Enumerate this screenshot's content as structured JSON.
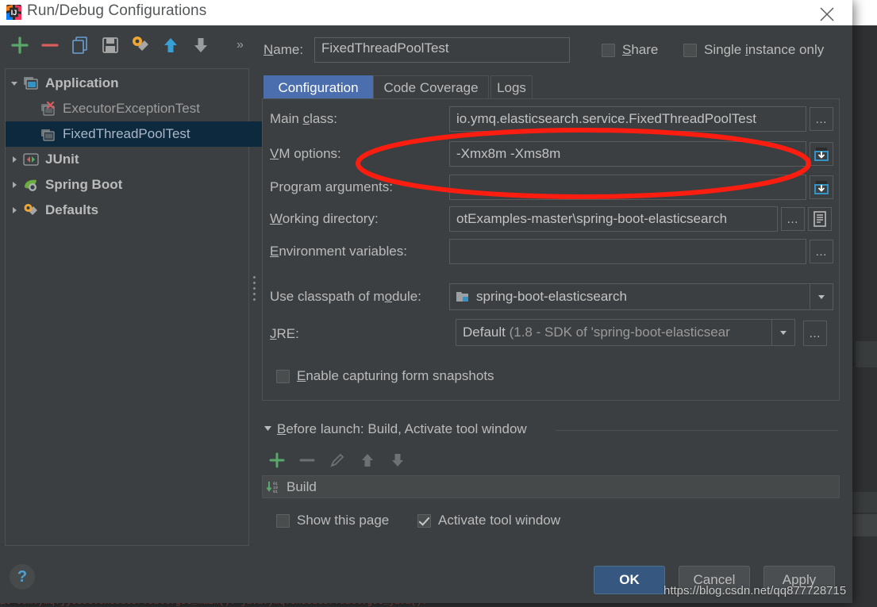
{
  "window": {
    "title": "Run/Debug Configurations",
    "app_icon": "intellij-idea-icon",
    "close_icon": "close-icon"
  },
  "toolbar": {
    "buttons": [
      {
        "name": "add-configuration-button",
        "icon": "plus-icon",
        "label": "+"
      },
      {
        "name": "remove-configuration-button",
        "icon": "minus-icon",
        "label": "−"
      },
      {
        "name": "copy-configuration-button",
        "icon": "copy-icon",
        "label": ""
      },
      {
        "name": "save-configuration-button",
        "icon": "save-floppy-icon",
        "label": ""
      },
      {
        "name": "edit-defaults-button",
        "icon": "wrench-gear-icon",
        "label": ""
      },
      {
        "name": "move-up-button",
        "icon": "arrow-up-icon",
        "label": ""
      },
      {
        "name": "move-down-button",
        "icon": "arrow-down-icon",
        "label": ""
      }
    ],
    "overflow_label": "»"
  },
  "name_field": {
    "label": "Name:",
    "label_mnemonic": "N",
    "value": "FixedThreadPoolTest",
    "placeholder": ""
  },
  "header_checkboxes": [
    {
      "name": "share-checkbox",
      "label": "Share",
      "mnemonic": "S",
      "checked": false
    },
    {
      "name": "single-instance-checkbox",
      "label": "Single instance only",
      "mnemonic": "i",
      "checked": false
    }
  ],
  "tree": {
    "nodes": [
      {
        "label": "Application",
        "icon": "application-folder-icon",
        "expanded": true,
        "bold": true,
        "indent": 0,
        "selected": false,
        "arrow": "down"
      },
      {
        "label": "ExecutorExceptionTest",
        "icon": "application-run-error-icon",
        "expanded": false,
        "bold": false,
        "indent": 1,
        "selected": false,
        "arrow": "none"
      },
      {
        "label": "FixedThreadPoolTest",
        "icon": "application-run-icon",
        "expanded": false,
        "bold": false,
        "indent": 1,
        "selected": true,
        "arrow": "none"
      },
      {
        "label": "JUnit",
        "icon": "junit-icon",
        "expanded": false,
        "bold": true,
        "indent": 0,
        "selected": false,
        "arrow": "right"
      },
      {
        "label": "Spring Boot",
        "icon": "spring-boot-leaf-icon",
        "expanded": false,
        "bold": true,
        "indent": 0,
        "selected": false,
        "arrow": "right"
      },
      {
        "label": "Defaults",
        "icon": "defaults-wrench-icon",
        "expanded": false,
        "bold": true,
        "indent": 0,
        "selected": false,
        "arrow": "right"
      }
    ]
  },
  "tabs": [
    {
      "name": "tab-configuration",
      "label": "Configuration",
      "active": true
    },
    {
      "name": "tab-code-coverage",
      "label": "Code Coverage",
      "active": false
    },
    {
      "name": "tab-logs",
      "label": "Logs",
      "active": false
    }
  ],
  "configuration": {
    "main_class": {
      "label": "Main class:",
      "mnemonic": "c",
      "value": "io.ymq.elasticsearch.service.FixedThreadPoolTest",
      "browse_label": "…"
    },
    "vm_options": {
      "label": "VM options:",
      "mnemonic": "V",
      "value": "-Xmx8m -Xms8m",
      "expand_icon": "expand-editor-icon"
    },
    "program_arguments": {
      "label": "Program arguments:",
      "mnemonic": "g",
      "value": "",
      "expand_icon": "expand-editor-icon"
    },
    "working_directory": {
      "label": "Working directory:",
      "mnemonic": "W",
      "value": "otExamples-master\\spring-boot-elasticsearch",
      "browse_label": "…",
      "macros_icon": "insert-macro-icon"
    },
    "environment_variables": {
      "label": "Environment variables:",
      "mnemonic": "E",
      "value": "",
      "browse_label": "…"
    },
    "classpath_module": {
      "label": "Use classpath of module:",
      "mnemonic": "o",
      "value": "spring-boot-elasticsearch",
      "icon": "module-icon",
      "arrow_icon": "chevron-down-icon"
    },
    "jre": {
      "label": "JRE:",
      "mnemonic": "J",
      "value_main": "Default ",
      "value_dim": "(1.8 - SDK of 'spring-boot-elasticsear",
      "arrow_icon": "chevron-down-icon",
      "browse_label": "…"
    },
    "snapshots_checkbox": {
      "name": "enable-capturing-form-snapshots-checkbox",
      "label": "Enable capturing form snapshots",
      "mnemonic": "E",
      "checked": false
    }
  },
  "before_launch": {
    "header": "Before launch: Build, Activate tool window",
    "mnemonic": "B",
    "collapse_icon": "triangle-down-icon",
    "toolbar": [
      {
        "name": "before-launch-add-button",
        "icon": "plus-icon",
        "enabled": true
      },
      {
        "name": "before-launch-remove-button",
        "icon": "minus-icon",
        "enabled": false
      },
      {
        "name": "before-launch-edit-button",
        "icon": "pencil-icon",
        "enabled": false
      },
      {
        "name": "before-launch-move-up-button",
        "icon": "arrow-up-icon",
        "enabled": false
      },
      {
        "name": "before-launch-move-down-button",
        "icon": "arrow-down-icon",
        "enabled": false
      }
    ],
    "tasks": [
      {
        "label": "Build",
        "icon": "build-compile-icon"
      }
    ],
    "checkboxes": [
      {
        "name": "show-this-page-checkbox",
        "label": "Show this page",
        "checked": false
      },
      {
        "name": "activate-tool-window-checkbox",
        "label": "Activate tool window",
        "checked": true
      }
    ]
  },
  "footer": {
    "help_label": "?",
    "buttons": [
      {
        "name": "ok-button",
        "label": "OK",
        "primary": true
      },
      {
        "name": "cancel-button",
        "label": "Cancel",
        "primary": false
      },
      {
        "name": "apply-button",
        "label": "Apply",
        "primary": false
      }
    ]
  },
  "annotation": {
    "shape": "red-ellipse-highlight",
    "color": "#fb1d10"
  },
  "watermark": {
    "text": "https://blog.csdn.net/qq877728715"
  },
  "background_console": {
    "text": "at com.ymq.jjtest.executor.call.get_main(): java.ymq.executor.call.get_java(): "
  }
}
